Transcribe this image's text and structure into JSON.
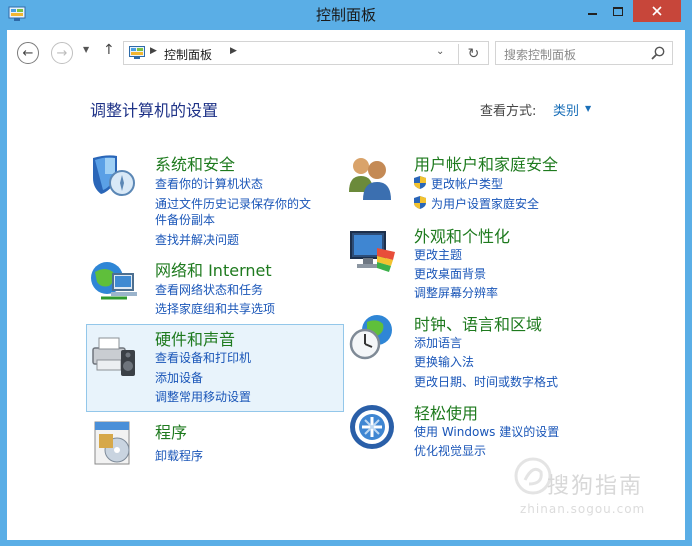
{
  "window": {
    "title": "控制面板"
  },
  "navigation": {
    "breadcrumb": "控制面板",
    "search_placeholder": "搜索控制面板"
  },
  "header": {
    "title": "调整计算机的设置",
    "view_by_label": "查看方式:",
    "view_by_value": "类别"
  },
  "categories": {
    "system_security": {
      "title": "系统和安全",
      "links": [
        "查看你的计算机状态",
        "通过文件历史记录保存你的文",
        "件备份副本",
        "查找并解决问题"
      ]
    },
    "network": {
      "title": "网络和 Internet",
      "links": [
        "查看网络状态和任务",
        "选择家庭组和共享选项"
      ]
    },
    "hardware": {
      "title": "硬件和声音",
      "links": [
        "查看设备和打印机",
        "添加设备",
        "调整常用移动设置"
      ]
    },
    "programs": {
      "title": "程序",
      "links": [
        "卸载程序"
      ]
    },
    "user_accounts": {
      "title": "用户帐户和家庭安全",
      "links": [
        "更改帐户类型",
        "为用户设置家庭安全"
      ]
    },
    "appearance": {
      "title": "外观和个性化",
      "links": [
        "更改主题",
        "更改桌面背景",
        "调整屏幕分辨率"
      ]
    },
    "clock_region": {
      "title": "时钟、语言和区域",
      "links": [
        "添加语言",
        "更换输入法",
        "更改日期、时间或数字格式"
      ]
    },
    "ease_of_access": {
      "title": "轻松使用",
      "links": [
        "使用 Windows 建议的设置",
        "优化视觉显示"
      ]
    }
  },
  "watermark": {
    "text": "搜狗指南",
    "url": "zhinan.sogou.com"
  },
  "colors": {
    "title_bar": "#5aaee6",
    "close_button": "#c7463a",
    "category_title": "#1e7a1e",
    "link": "#1a56b8",
    "heading": "#1e3287",
    "hover_highlight": "#e8f3fb"
  }
}
